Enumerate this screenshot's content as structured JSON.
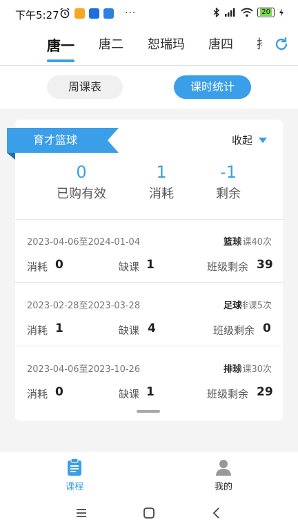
{
  "status_bar": {
    "time": "下午5:27",
    "battery": "20",
    "more": "···"
  },
  "tabs": [
    {
      "label": "唐一",
      "active": true
    },
    {
      "label": "唐二",
      "active": false
    },
    {
      "label": "恕瑞玛",
      "active": false
    },
    {
      "label": "唐四",
      "active": false
    },
    {
      "label": "排",
      "active": false
    }
  ],
  "segment": {
    "weekly": "周课表",
    "stats": "课时统计"
  },
  "card": {
    "title": "育才篮球",
    "collapse": "收起",
    "summary": [
      {
        "value": "0",
        "label": "已购有效"
      },
      {
        "value": "1",
        "label": "消耗"
      },
      {
        "value": "-1",
        "label": "剩余"
      }
    ],
    "rows": [
      {
        "date": "2023-04-06至2024-01-04",
        "sport": "篮球",
        "schedule": "排课40次",
        "consumed_label": "消耗",
        "consumed": "0",
        "absent_label": "缺课",
        "absent": "1",
        "remain_label": "班级剩余",
        "remain": "39"
      },
      {
        "date": "2023-02-28至2023-03-28",
        "sport": "足球",
        "schedule": "排课5次",
        "consumed_label": "消耗",
        "consumed": "1",
        "absent_label": "缺课",
        "absent": "4",
        "remain_label": "班级剩余",
        "remain": "0"
      },
      {
        "date": "2023-04-06至2023-10-26",
        "sport": "排球",
        "schedule": "排课30次",
        "consumed_label": "消耗",
        "consumed": "0",
        "absent_label": "缺课",
        "absent": "1",
        "remain_label": "班级剩余",
        "remain": "29"
      }
    ]
  },
  "bottom_nav": {
    "course": "课程",
    "me": "我的"
  },
  "colors": {
    "accent": "#3a9ee8"
  }
}
